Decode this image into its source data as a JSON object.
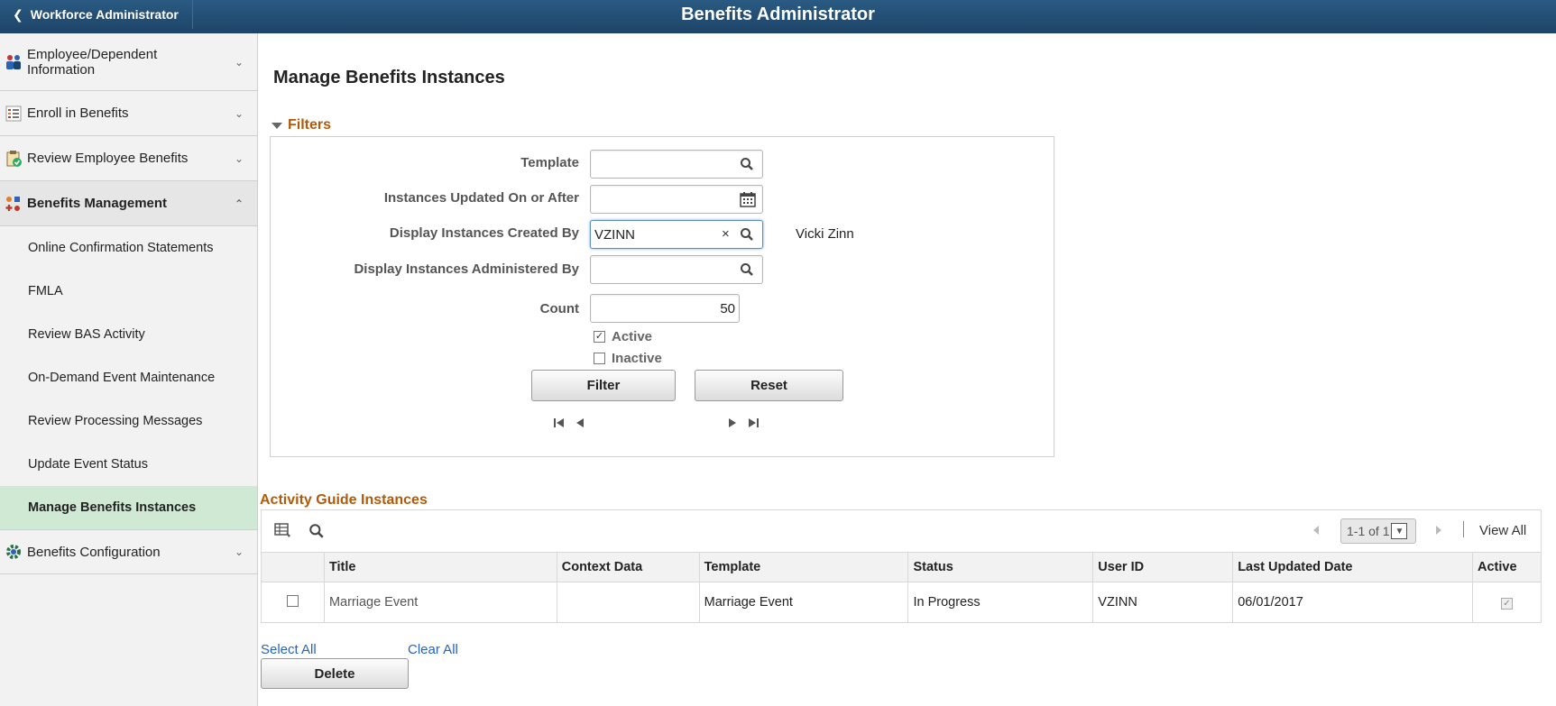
{
  "topbar": {
    "back_label": "Workforce Administrator",
    "title": "Benefits Administrator"
  },
  "sidebar": {
    "groups": [
      {
        "label": "Employee/Dependent Information",
        "icon": "people-icon"
      },
      {
        "label": "Enroll in Benefits",
        "icon": "enroll-list-icon"
      },
      {
        "label": "Review Employee Benefits",
        "icon": "clipboard-check-icon"
      },
      {
        "label": "Benefits Management",
        "icon": "benefits-management-icon"
      },
      {
        "label": "Benefits Configuration",
        "icon": "gear-icon"
      }
    ],
    "sub_items": [
      "Online Confirmation Statements",
      "FMLA",
      "Review BAS Activity",
      "On-Demand Event Maintenance",
      "Review Processing Messages",
      "Update Event Status",
      "Manage Benefits Instances"
    ]
  },
  "page": {
    "title": "Manage Benefits Instances"
  },
  "filters": {
    "heading": "Filters",
    "template_label": "Template",
    "template_value": "",
    "updated_label": "Instances Updated On or After",
    "updated_value": "",
    "created_by_label": "Display Instances Created By",
    "created_by_value": "VZINN",
    "created_by_name": "Vicki Zinn",
    "clear_glyph": "×",
    "administered_by_label": "Display Instances Administered By",
    "administered_by_value": "",
    "count_label": "Count",
    "count_value": "50",
    "active_label": "Active",
    "active_checked": true,
    "inactive_label": "Inactive",
    "inactive_checked": false,
    "filter_button": "Filter",
    "reset_button": "Reset"
  },
  "activity_guide": {
    "heading": "Activity Guide Instances",
    "pager_text": "1-1 of 1",
    "view_all": "View All",
    "columns": [
      "Title",
      "Context Data",
      "Template",
      "Status",
      "User ID",
      "Last Updated Date",
      "Active"
    ],
    "rows": [
      {
        "title": "Marriage Event",
        "context_data": "",
        "template": "Marriage Event",
        "status": "In Progress",
        "user_id": "VZINN",
        "last_updated": "06/01/2017",
        "active": true
      }
    ],
    "select_all": "Select All",
    "clear_all": "Clear All",
    "delete_button": "Delete"
  },
  "colors": {
    "topbar": "#1d4468",
    "section_heading": "#b05b0c",
    "link": "#2a63b8",
    "active_nav": "#cfe9d5"
  }
}
